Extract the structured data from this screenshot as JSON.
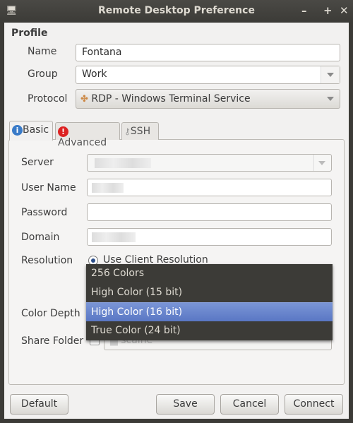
{
  "window": {
    "title": "Remote Desktop Preference",
    "minimize": "–",
    "maximize": "+",
    "close": "✕"
  },
  "profile": {
    "heading": "Profile",
    "name_label": "Name",
    "name_value": "Fontana",
    "group_label": "Group",
    "group_value": "Work",
    "protocol_label": "Protocol",
    "protocol_value": "RDP - Windows Terminal Service"
  },
  "tabs": [
    {
      "label": "Basic",
      "icon": "info-icon",
      "active": true
    },
    {
      "label": "Advanced",
      "icon": "warning-icon"
    },
    {
      "label": "SSH",
      "icon": "key-icon"
    }
  ],
  "basic": {
    "server_label": "Server",
    "username_label": "User Name",
    "password_label": "Password",
    "domain_label": "Domain",
    "resolution_label": "Resolution",
    "resolution_option": "Use Client Resolution",
    "color_depth_label": "Color Depth",
    "share_folder_label": "Share Folder",
    "share_folder_value": "scaine"
  },
  "color_depth_popup": {
    "options": [
      "256 Colors",
      "High Color (15 bit)",
      "High Color (16 bit)",
      "True Color (24 bit)"
    ],
    "selected": "High Color (16 bit)"
  },
  "buttons": {
    "default": "Default",
    "save": "Save",
    "cancel": "Cancel",
    "connect": "Connect"
  },
  "colors": {
    "titlebar": "#3c3b37",
    "highlight": "#6a86cc",
    "background": "#f2f1f0"
  }
}
